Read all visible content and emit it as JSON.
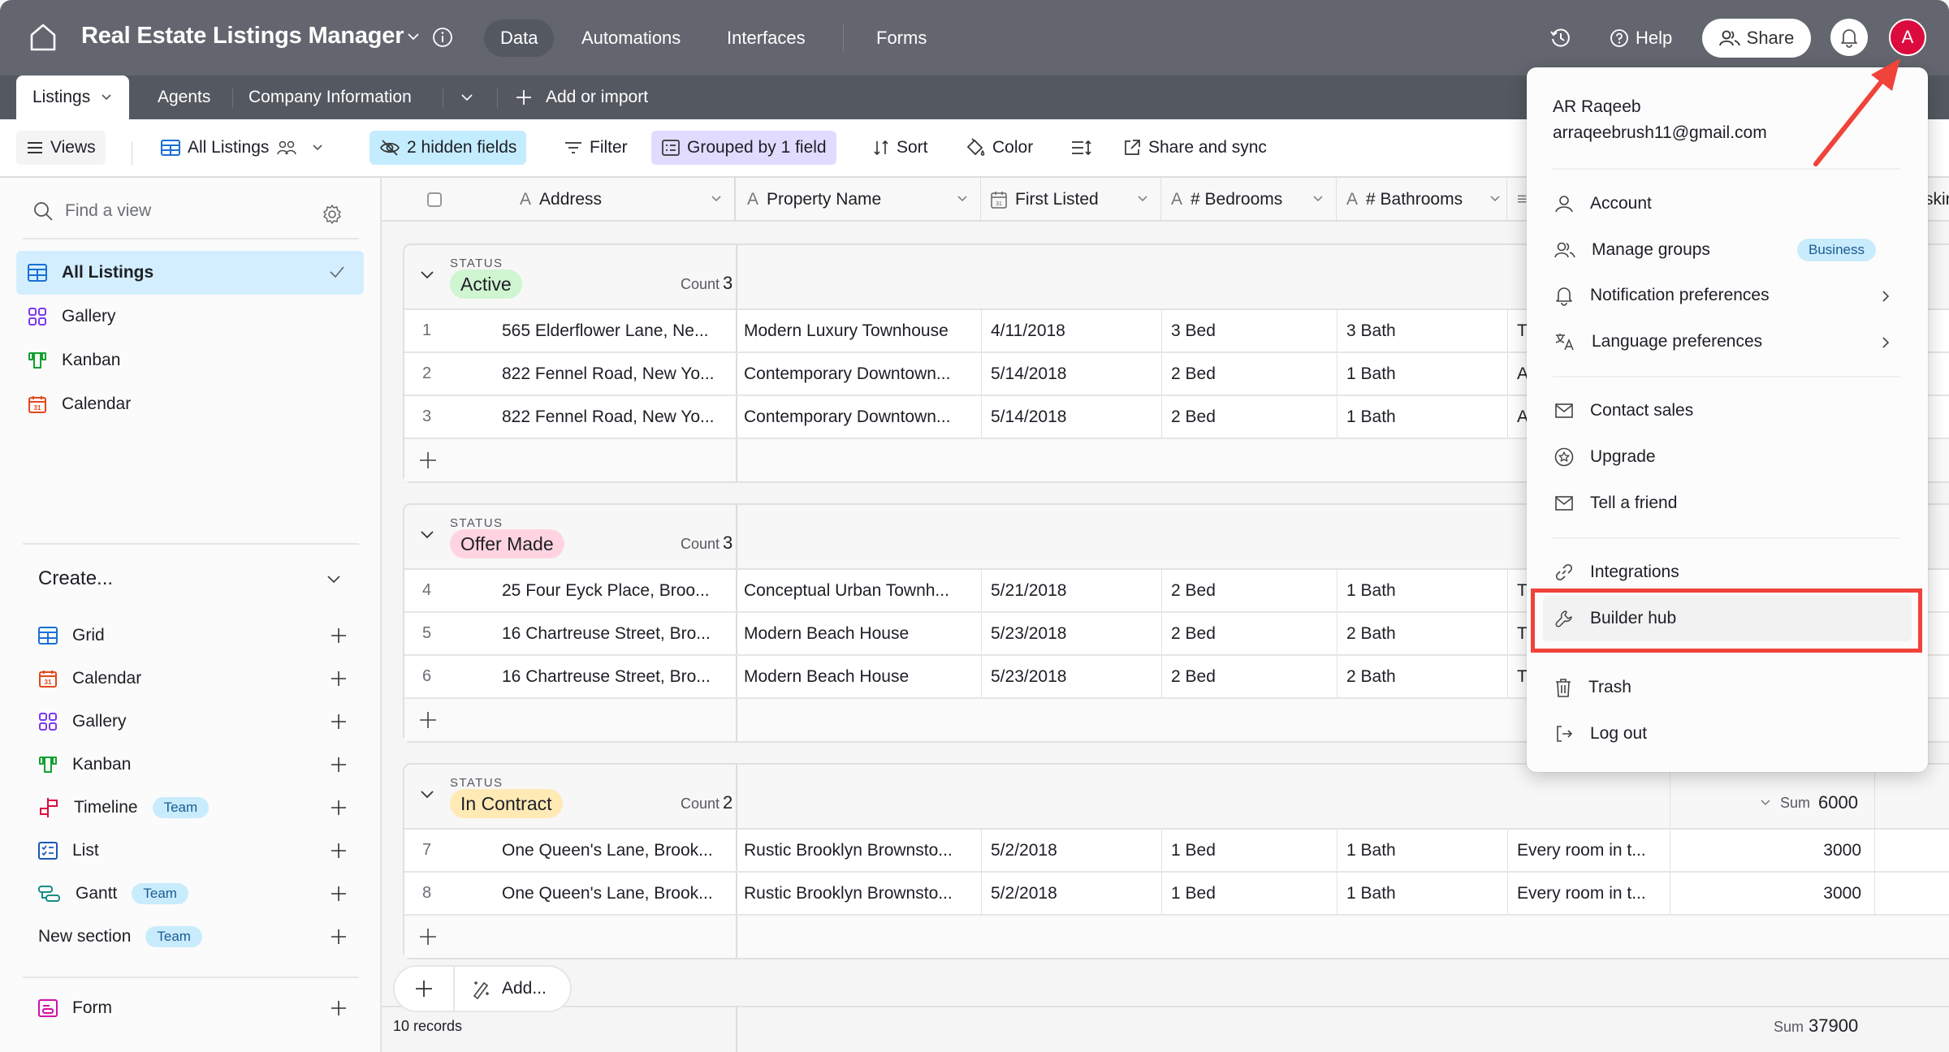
{
  "topbar": {
    "title": "Real Estate Listings Manager",
    "nav": [
      "Data",
      "Automations",
      "Interfaces",
      "Forms"
    ],
    "active_nav": "Data",
    "help_label": "Help",
    "share_label": "Share",
    "avatar_initial": "A"
  },
  "tabs": {
    "items": [
      "Listings",
      "Agents",
      "Company Information"
    ],
    "active": "Listings",
    "add_label": "Add or import"
  },
  "toolbar": {
    "views_label": "Views",
    "view_name": "All Listings",
    "hidden_fields_label": "2 hidden fields",
    "filter_label": "Filter",
    "grouped_label": "Grouped by 1 field",
    "sort_label": "Sort",
    "color_label": "Color",
    "share_sync_label": "Share and sync"
  },
  "sidebar": {
    "search_placeholder": "Find a view",
    "views": [
      {
        "label": "All Listings",
        "icon": "grid-icon",
        "active": true
      },
      {
        "label": "Gallery",
        "icon": "gallery-icon"
      },
      {
        "label": "Kanban",
        "icon": "kanban-icon"
      },
      {
        "label": "Calendar",
        "icon": "calendar-icon"
      }
    ],
    "create_title": "Create...",
    "create_items": [
      {
        "label": "Grid",
        "icon": "grid-icon"
      },
      {
        "label": "Calendar",
        "icon": "calendar-icon"
      },
      {
        "label": "Gallery",
        "icon": "gallery-icon"
      },
      {
        "label": "Kanban",
        "icon": "kanban-icon"
      },
      {
        "label": "Timeline",
        "icon": "timeline-icon",
        "badge": "Team"
      },
      {
        "label": "List",
        "icon": "list-icon"
      },
      {
        "label": "Gantt",
        "icon": "gantt-icon",
        "badge": "Team"
      },
      {
        "label": "New section",
        "badge": "Team"
      },
      {
        "label": "Form",
        "icon": "form-icon"
      }
    ]
  },
  "grid": {
    "columns": [
      "Address",
      "Property Name",
      "First Listed",
      "# Bedrooms",
      "# Bathrooms"
    ],
    "partial_column_fragment": "skin",
    "group_field_label": "STATUS",
    "count_label": "Count",
    "sum_label": "Sum",
    "groups": [
      {
        "status": "Active",
        "color": "#cff5d1",
        "count": "3",
        "rows": [
          {
            "num": "1",
            "address": "565 Elderflower Lane, Ne...",
            "property": "Modern Luxury Townhouse",
            "listed": "4/11/2018",
            "bedrooms": "3 Bed",
            "bathrooms": "3 Bath",
            "desc": "T"
          },
          {
            "num": "2",
            "address": "822 Fennel Road, New Yo...",
            "property": "Contemporary Downtown...",
            "listed": "5/14/2018",
            "bedrooms": "2 Bed",
            "bathrooms": "1 Bath",
            "desc": "A"
          },
          {
            "num": "3",
            "address": "822 Fennel Road, New Yo...",
            "property": "Contemporary Downtown...",
            "listed": "5/14/2018",
            "bedrooms": "2 Bed",
            "bathrooms": "1 Bath",
            "desc": "A"
          }
        ]
      },
      {
        "status": "Offer Made",
        "color": "#ffd4e0",
        "count": "3",
        "rows": [
          {
            "num": "4",
            "address": "25 Four Eyck Place, Broo...",
            "property": "Conceptual Urban Townh...",
            "listed": "5/21/2018",
            "bedrooms": "2 Bed",
            "bathrooms": "1 Bath",
            "desc": "T"
          },
          {
            "num": "5",
            "address": "16 Chartreuse Street, Bro...",
            "property": "Modern Beach House",
            "listed": "5/23/2018",
            "bedrooms": "2 Bed",
            "bathrooms": "2 Bath",
            "desc": "T"
          },
          {
            "num": "6",
            "address": "16 Chartreuse Street, Bro...",
            "property": "Modern Beach House",
            "listed": "5/23/2018",
            "bedrooms": "2 Bed",
            "bathrooms": "2 Bath",
            "desc": "T"
          }
        ]
      },
      {
        "status": "In Contract",
        "color": "#ffeab6",
        "count": "2",
        "sum": "6000",
        "rows": [
          {
            "num": "7",
            "address": "One Queen's Lane, Brook...",
            "property": "Rustic Brooklyn Brownsto...",
            "listed": "5/2/2018",
            "bedrooms": "1 Bed",
            "bathrooms": "1 Bath",
            "desc": "Every room in t...",
            "price": "3000"
          },
          {
            "num": "8",
            "address": "One Queen's Lane, Brook...",
            "property": "Rustic Brooklyn Brownsto...",
            "listed": "5/2/2018",
            "bedrooms": "1 Bed",
            "bathrooms": "1 Bath",
            "desc": "Every room in t...",
            "price": "3000"
          }
        ]
      }
    ],
    "add_label": "Add...",
    "records_label": "10 records",
    "total_sum": "37900"
  },
  "account_menu": {
    "name": "AR Raqeeb",
    "email": "arraqeebrush11@gmail.com",
    "items": [
      {
        "label": "Account",
        "icon": "user-icon"
      },
      {
        "label": "Manage groups",
        "icon": "users-icon",
        "badge": "Business"
      },
      {
        "label": "Notification preferences",
        "icon": "bell-icon",
        "submenu": true
      },
      {
        "label": "Language preferences",
        "icon": "translate-icon",
        "submenu": true
      },
      {
        "label": "Contact sales",
        "icon": "mail-icon"
      },
      {
        "label": "Upgrade",
        "icon": "star-circle-icon"
      },
      {
        "label": "Tell a friend",
        "icon": "mail-icon"
      },
      {
        "label": "Integrations",
        "icon": "link-icon"
      },
      {
        "label": "Builder hub",
        "icon": "wrench-icon",
        "highlighted": true
      },
      {
        "label": "Trash",
        "icon": "trash-icon"
      },
      {
        "label": "Log out",
        "icon": "logout-icon"
      }
    ]
  },
  "annotation": {
    "highlight_color": "#f0433a",
    "highlight_target": "Builder hub"
  }
}
